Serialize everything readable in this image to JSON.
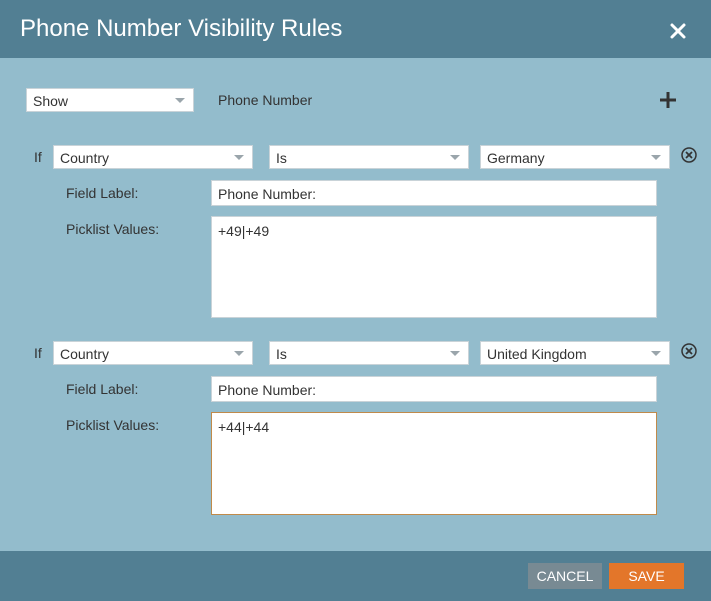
{
  "dialog": {
    "title": "Phone Number Visibility Rules"
  },
  "top_row": {
    "visibility_select": "Show",
    "field_name": "Phone Number"
  },
  "rules": [
    {
      "if_label": "If",
      "field_select": "Country",
      "operator_select": "Is",
      "value_select": "Germany",
      "field_label_caption": "Field Label:",
      "field_label_value": "Phone Number:",
      "picklist_caption": "Picklist Values:",
      "picklist_value": "+49|+49"
    },
    {
      "if_label": "If",
      "field_select": "Country",
      "operator_select": "Is",
      "value_select": "United Kingdom",
      "field_label_caption": "Field Label:",
      "field_label_value": "Phone Number:",
      "picklist_caption": "Picklist Values:",
      "picklist_value": "+44|+44"
    }
  ],
  "footer": {
    "cancel_label": "CANCEL",
    "save_label": "SAVE"
  },
  "colors": {
    "titlebar": "#527f93",
    "body": "#93bccc",
    "save_button": "#e3762a",
    "cancel_button": "#788a93"
  },
  "icons": {
    "close": "close-icon",
    "add": "plus-icon",
    "remove": "circle-x-icon"
  }
}
